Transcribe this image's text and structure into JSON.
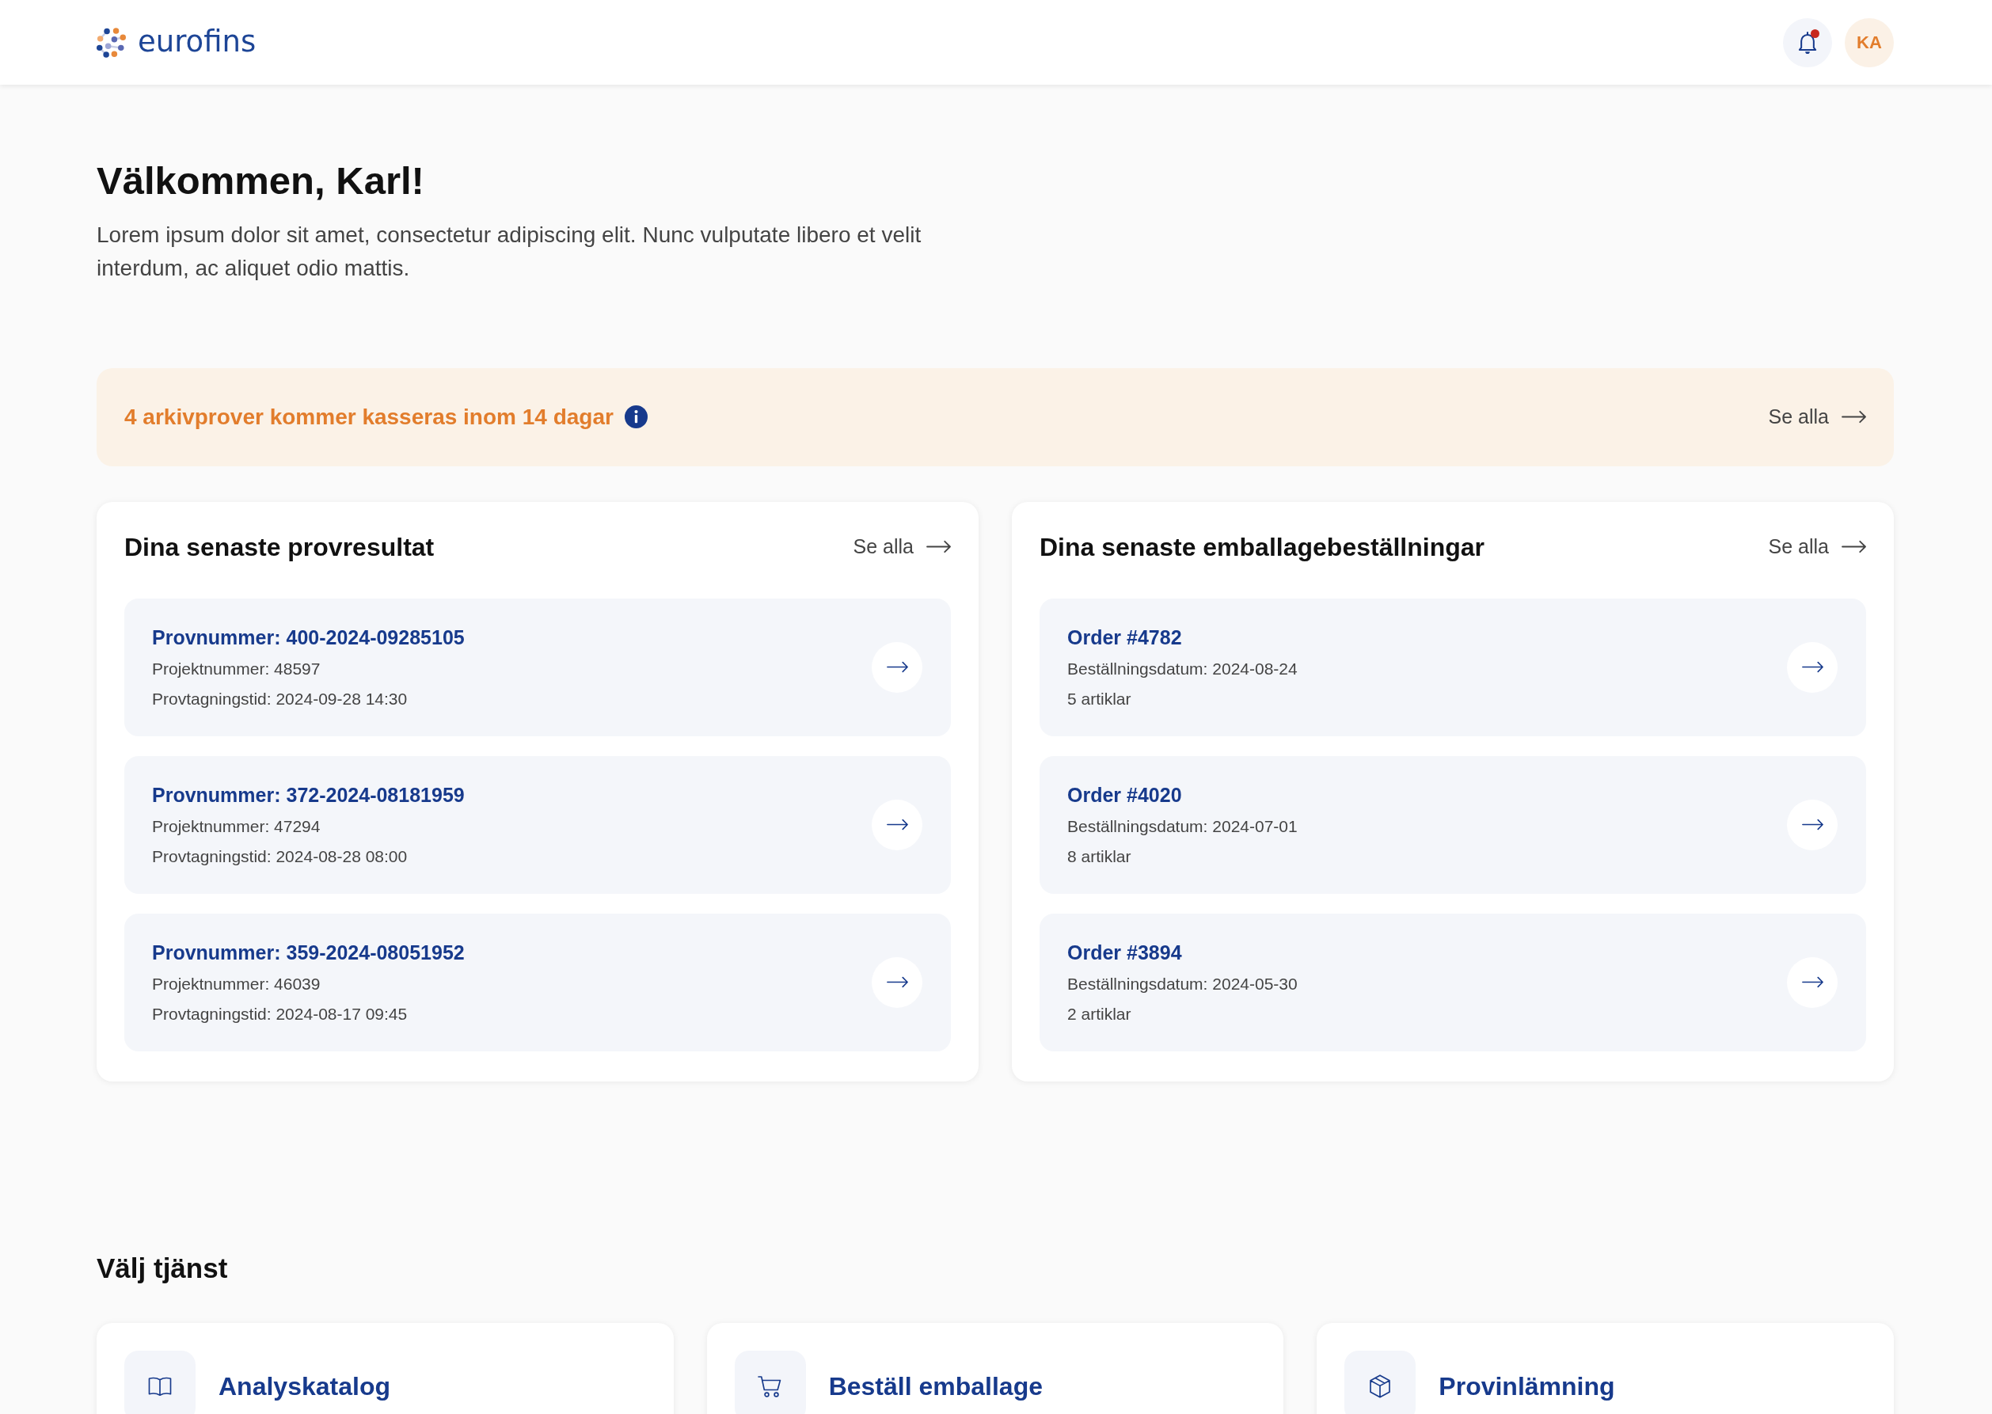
{
  "header": {
    "logo_text": "eurofins",
    "has_unread_notifications": true,
    "avatar_initials": "KA"
  },
  "welcome": {
    "title": "Välkommen, Karl!",
    "text": "Lorem ipsum dolor sit amet, consectetur adipiscing elit. Nunc vulputate libero et velit interdum, ac aliquet odio mattis."
  },
  "alert": {
    "text": "4 arkivprover kommer kasseras inom 14 dagar",
    "link": "Se alla"
  },
  "panels": [
    {
      "title": "Dina senaste provresultat",
      "link": "Se alla",
      "items": [
        {
          "title": "Provnummer: 400-2024-09285105",
          "details": [
            "Projektnummer: 48597",
            "Provtagningstid: 2024-09-28 14:30"
          ]
        },
        {
          "title": "Provnummer: 372-2024-08181959",
          "details": [
            "Projektnummer: 47294",
            "Provtagningstid: 2024-08-28 08:00"
          ]
        },
        {
          "title": "Provnummer: 359-2024-08051952",
          "details": [
            "Projektnummer: 46039",
            "Provtagningstid: 2024-08-17 09:45"
          ]
        }
      ]
    },
    {
      "title": "Dina senaste emballagebeställningar",
      "link": "Se alla",
      "items": [
        {
          "title": "Order #4782",
          "details": [
            "Beställningsdatum: 2024-08-24",
            "5 artiklar"
          ]
        },
        {
          "title": "Order #4020",
          "details": [
            "Beställningsdatum: 2024-07-01",
            "8 artiklar"
          ]
        },
        {
          "title": "Order #3894",
          "details": [
            "Beställningsdatum: 2024-05-30",
            "2 artiklar"
          ]
        }
      ]
    }
  ],
  "services": {
    "title": "Välj tjänst",
    "items": [
      {
        "label": "Analyskatalog"
      },
      {
        "label": "Beställ emballage"
      },
      {
        "label": "Provinlämning"
      }
    ]
  }
}
